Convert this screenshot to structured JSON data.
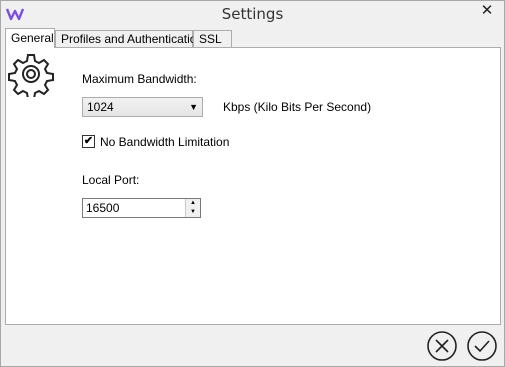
{
  "window": {
    "title": "Settings",
    "close_glyph": "✕",
    "app_icon": "w-logo-icon"
  },
  "tabs": [
    {
      "label": "General",
      "active": true
    },
    {
      "label": "Profiles and Authentication",
      "active": false
    },
    {
      "label": "SSL",
      "active": false
    }
  ],
  "general": {
    "icon": "gear-icon",
    "bandwidth_label": "Maximum Bandwidth:",
    "bandwidth_value": "1024",
    "bandwidth_unit": "Kbps (Kilo Bits Per Second)",
    "no_limit_label": "No Bandwidth Limitation",
    "no_limit_checked": true,
    "check_glyph": "✔",
    "port_label": "Local Port:",
    "port_value": "16500"
  },
  "footer": {
    "cancel_icon": "cancel-icon",
    "ok_icon": "ok-icon"
  },
  "colors": {
    "accent": "#8b5cf6",
    "border": "#adadad"
  }
}
